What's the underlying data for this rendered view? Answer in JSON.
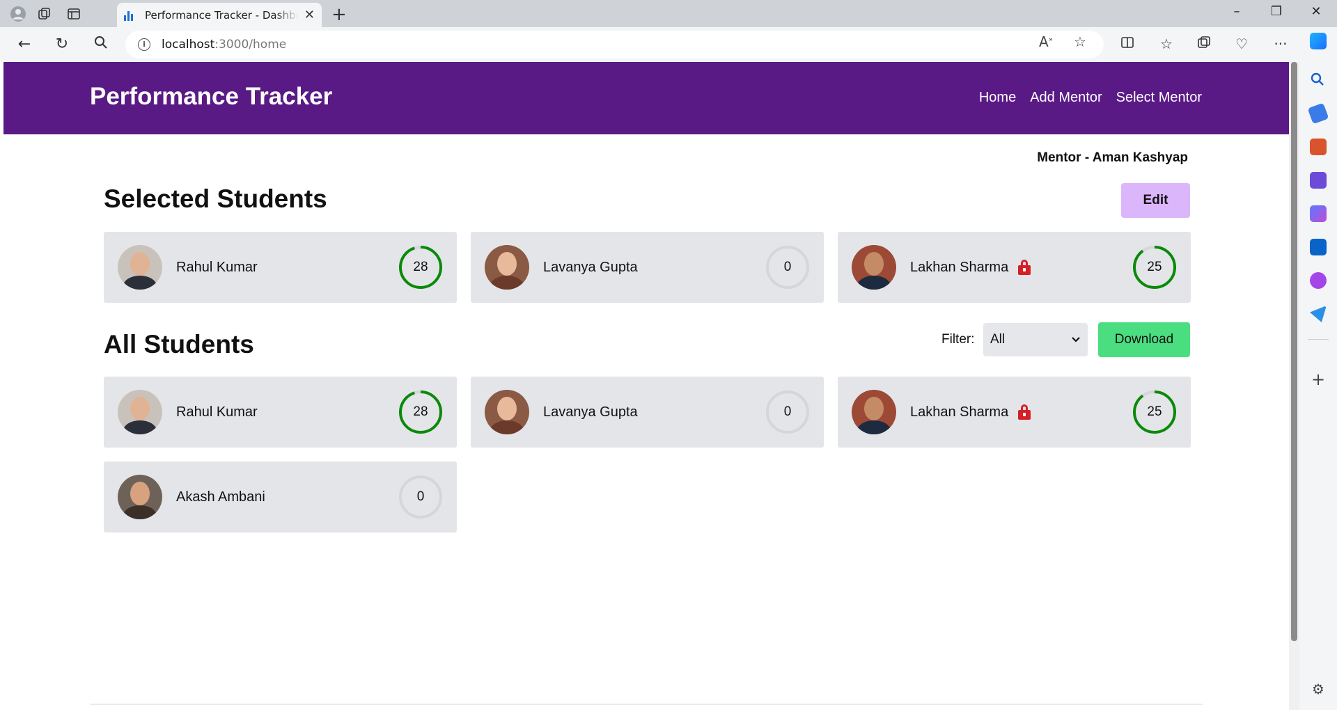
{
  "browser": {
    "tab_title": "Performance Tracker - Dashboard",
    "url_host": "localhost",
    "url_path": ":3000/home"
  },
  "app": {
    "brand": "Performance Tracker",
    "nav": [
      "Home",
      "Add Mentor",
      "Select Mentor"
    ],
    "mentor_label": "Mentor - Aman Kashyap"
  },
  "selected": {
    "title": "Selected Students",
    "edit_label": "Edit",
    "students": [
      {
        "name": "Rahul Kumar",
        "score": "28",
        "locked": false,
        "progress": 0.95
      },
      {
        "name": "Lavanya Gupta",
        "score": "0",
        "locked": false,
        "progress": 0
      },
      {
        "name": "Lakhan Sharma",
        "score": "25",
        "locked": true,
        "progress": 0.9
      }
    ]
  },
  "all": {
    "title": "All Students",
    "filter_label": "Filter:",
    "filter_value": "All",
    "download_label": "Download",
    "students": [
      {
        "name": "Rahul Kumar",
        "score": "28",
        "locked": false,
        "progress": 0.95
      },
      {
        "name": "Lavanya Gupta",
        "score": "0",
        "locked": false,
        "progress": 0
      },
      {
        "name": "Lakhan Sharma",
        "score": "25",
        "locked": true,
        "progress": 0.9
      },
      {
        "name": "Akash Ambani",
        "score": "0",
        "locked": false,
        "progress": 0
      }
    ]
  },
  "colors": {
    "header": "#5a1a86",
    "edit_button": "#dbb6fb",
    "download_button": "#4ade80",
    "score_ring": "#0a8a0a",
    "lock": "#d61f26"
  }
}
